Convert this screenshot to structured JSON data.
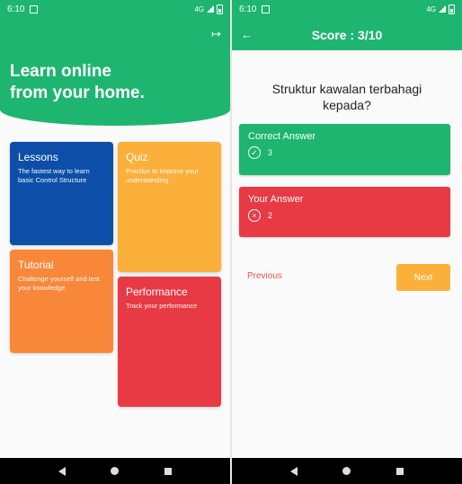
{
  "status": {
    "time": "6:10",
    "network": "4G"
  },
  "home": {
    "title_line1": "Learn online",
    "title_line2": "from your home.",
    "cards": [
      {
        "title": "Lessons",
        "desc": "The fastest way to learn basic Control Structure",
        "color": "#0d4fa8"
      },
      {
        "title": "Quiz",
        "desc": "Practice to improve your understanding",
        "color": "#fbb03b"
      },
      {
        "title": "Tutorial",
        "desc": "Challenge yourself and test your knowledge",
        "color": "#f8873a"
      },
      {
        "title": "Performance",
        "desc": "Track your performance",
        "color": "#e73a45"
      }
    ]
  },
  "result": {
    "title": "Score : 3/10",
    "question": "Struktur kawalan terbahagi kepada?",
    "correct_label": "Correct Answer",
    "correct_value": "3",
    "your_label": "Your Answer",
    "your_value": "2",
    "previous": "Previous",
    "next": "Next"
  },
  "colors": {
    "brand_green": "#1db56f",
    "red": "#e73a45",
    "orange": "#fbb03b"
  },
  "icons": {
    "logout": "logout-icon",
    "back": "arrow-left-icon",
    "check": "check-circle-icon",
    "close": "close-circle-icon"
  }
}
